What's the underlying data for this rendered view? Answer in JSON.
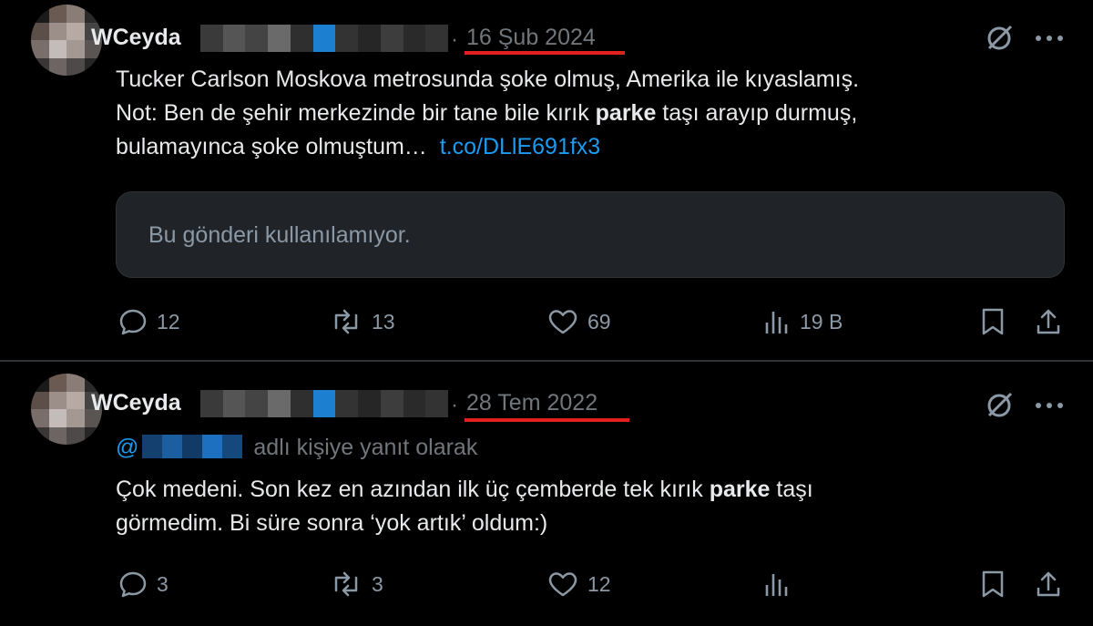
{
  "tweets": [
    {
      "author_name": "WCeyda",
      "separator": "·",
      "date": "16 Şub 2024",
      "text_line1": "Tucker Carlson Moskova metrosunda şoke olmuş, Amerika ile kıyaslamış.",
      "text_line2_before": "Not: Ben de şehir merkezinde bir tane bile kırık ",
      "text_line2_bold": "parke",
      "text_line2_after": " taşı arayıp durmuş,",
      "text_line3": "bulamayınca şoke olmuştum…",
      "link": "t.co/DLlE691fx3",
      "unavailable_notice": "Bu gönderi kullanılamıyor.",
      "actions": {
        "replies": "12",
        "reposts": "13",
        "likes": "69",
        "views": "19 B"
      }
    },
    {
      "author_name": "WCeyda",
      "separator": "·",
      "date": "28 Tem 2022",
      "reply_at": "@",
      "reply_suffix": "adlı kişiye yanıt olarak",
      "text_line1_before": "Çok medeni. Son kez en azından ilk üç çemberde tek kırık ",
      "text_line1_bold": "parke",
      "text_line1_after": " taşı",
      "text_line2": "görmedim. Bi süre sonra ‘yok artık’ oldum:)",
      "actions": {
        "replies": "3",
        "reposts": "3",
        "likes": "12"
      }
    }
  ],
  "icons": [
    "reply-icon",
    "repost-icon",
    "like-icon",
    "views-icon",
    "bookmark-icon",
    "share-icon",
    "grok-icon",
    "more-icon"
  ],
  "colors": {
    "accent": "#1d9bf0",
    "muted": "#71767b",
    "highlight_underline": "#e0201c",
    "background": "#000000"
  }
}
